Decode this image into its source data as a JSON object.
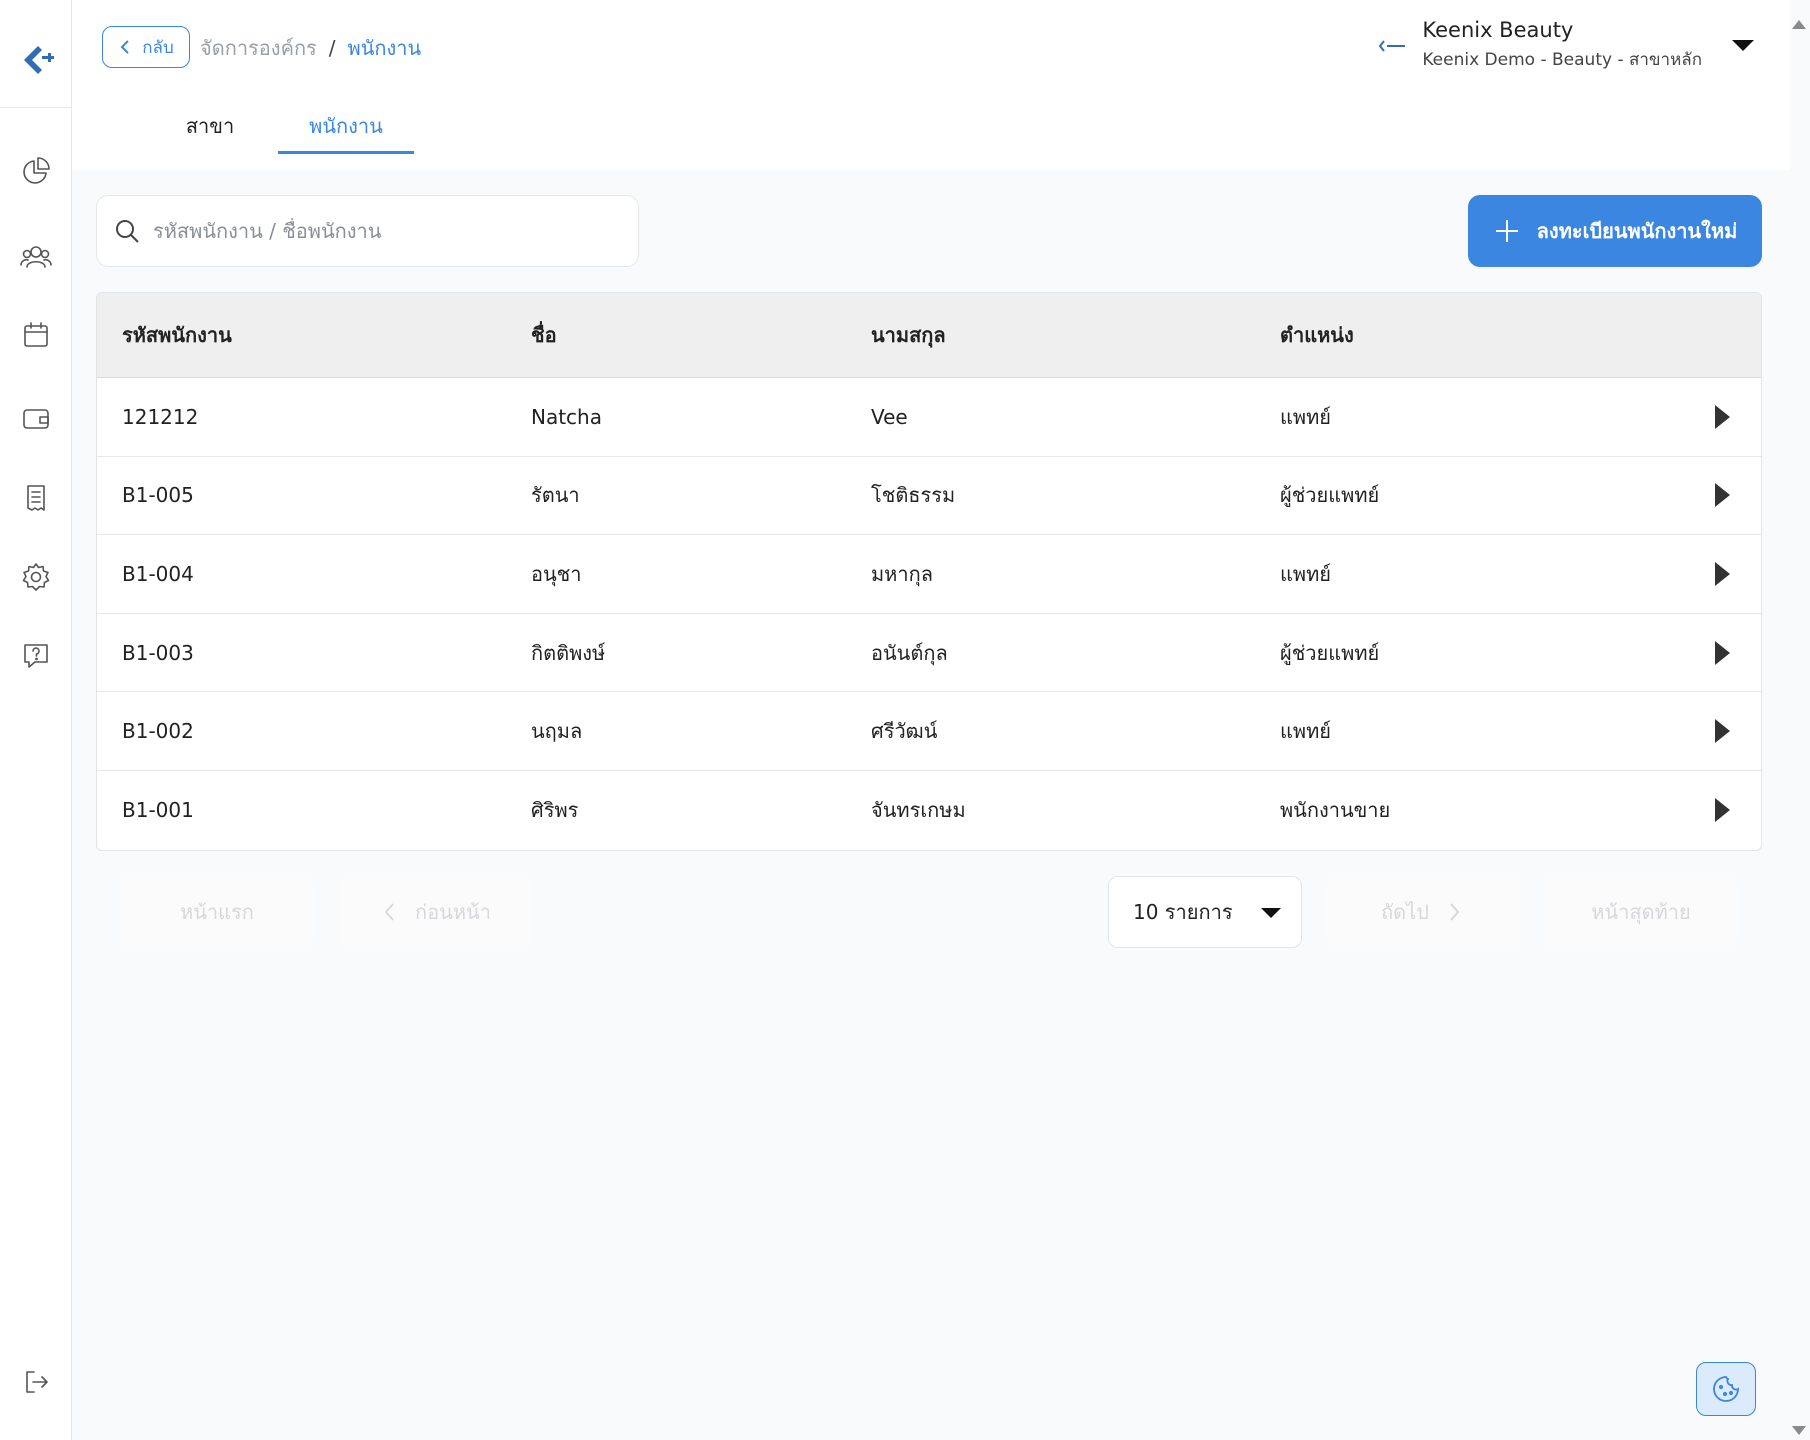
{
  "header": {
    "back_label": "กลับ",
    "breadcrumb": [
      "จัดการองค์กร",
      "/",
      "พนักงาน"
    ],
    "org_name": "Keenix Beauty",
    "org_branch": "Keenix Demo - Beauty - สาขาหลัก"
  },
  "tabs": [
    {
      "label": "สาขา",
      "active": false
    },
    {
      "label": "พนักงาน",
      "active": true
    }
  ],
  "sidebar": {
    "icons": [
      "dashboard-pie-icon",
      "customers-icon",
      "calendar-icon",
      "wallet-icon",
      "receipt-icon",
      "settings-icon",
      "help-chat-icon",
      "logout-icon"
    ]
  },
  "search": {
    "placeholder": "รหัสพนักงาน / ชื่อพนักงาน",
    "value": ""
  },
  "add_button_label": "ลงทะเบียนพนักงานใหม่",
  "table": {
    "columns": [
      "รหัสพนักงาน",
      "ชื่อ",
      "นามสกุล",
      "ตำแหน่ง"
    ],
    "rows": [
      {
        "id": "121212",
        "first": "Natcha",
        "last": "Vee",
        "position": "แพทย์"
      },
      {
        "id": "B1-005",
        "first": "รัตนา",
        "last": "โชติธรรม",
        "position": "ผู้ช่วยแพทย์"
      },
      {
        "id": "B1-004",
        "first": "อนุชา",
        "last": "มหากุล",
        "position": "แพทย์"
      },
      {
        "id": "B1-003",
        "first": "กิตติพงษ์",
        "last": "อนันต์กุล",
        "position": "ผู้ช่วยแพทย์"
      },
      {
        "id": "B1-002",
        "first": "นฤมล",
        "last": "ศรีวัฒน์",
        "position": "แพทย์"
      },
      {
        "id": "B1-001",
        "first": "ศิริพร",
        "last": "จันทรเกษม",
        "position": "พนักงานขาย"
      }
    ]
  },
  "pagination": {
    "first": "หน้าแรก",
    "prev": "ก่อนหน้า",
    "page_size": "10 รายการ",
    "next": "ถัดไป",
    "last": "หน้าสุดท้าย"
  },
  "colors": {
    "accent": "#3a86e0",
    "disabled_text": "#d6d8db",
    "table_header_bg": "#efefef"
  }
}
